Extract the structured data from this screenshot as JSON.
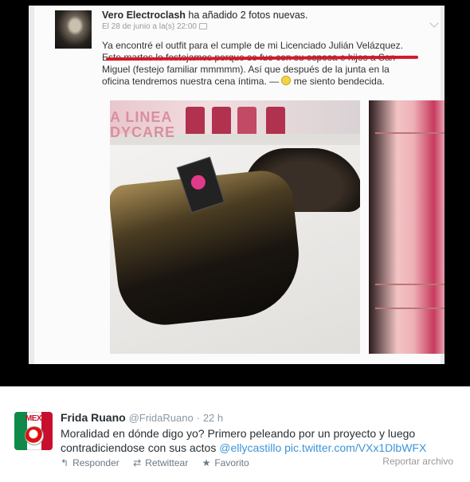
{
  "media": {
    "facebook_post": {
      "author": "Vero Electroclash",
      "action": " ha añadido 2 fotos nuevas.",
      "date": "El 28 de junio a la(s) 22:00",
      "text_lines": [
        "Ya encontré el outfit para el cumple de mi Licenciado Julián Velázquez.",
        "Este martes lo festejamos porque se fue con su esposa e hijos a San",
        "Miguel (festejo familiar mmmmm). Así que después de la junta en la",
        "oficina tendremos nuestra cena íntima. — "
      ],
      "feeling": " me siento bendecida.",
      "photo_sign_lines": [
        "A LINEA",
        "DYCARE"
      ]
    }
  },
  "tweet": {
    "name": "Frida Ruano",
    "handle": "@FridaRuano",
    "separator": "·",
    "time": "22 h",
    "avatar_text": "MEX",
    "text_line1": "Moralidad en dónde digo yo? Primero peleando por un proyecto y luego",
    "text_line2": "contradiciendose con sus actos ",
    "mention": "@ellycastillo",
    "link": "pic.twitter.com/VXx1DlbWFX",
    "actions": {
      "reply": "Responder",
      "retweet": "Retwittear",
      "favorite": "Favorito"
    },
    "report": "Reportar archivo"
  },
  "icons": {
    "reply": "reply-arrow-icon",
    "retweet": "retweet-icon",
    "favorite": "star-icon"
  },
  "colors": {
    "link": "#3b94d9",
    "underline": "#d4182a",
    "meta": "#8899a6"
  }
}
